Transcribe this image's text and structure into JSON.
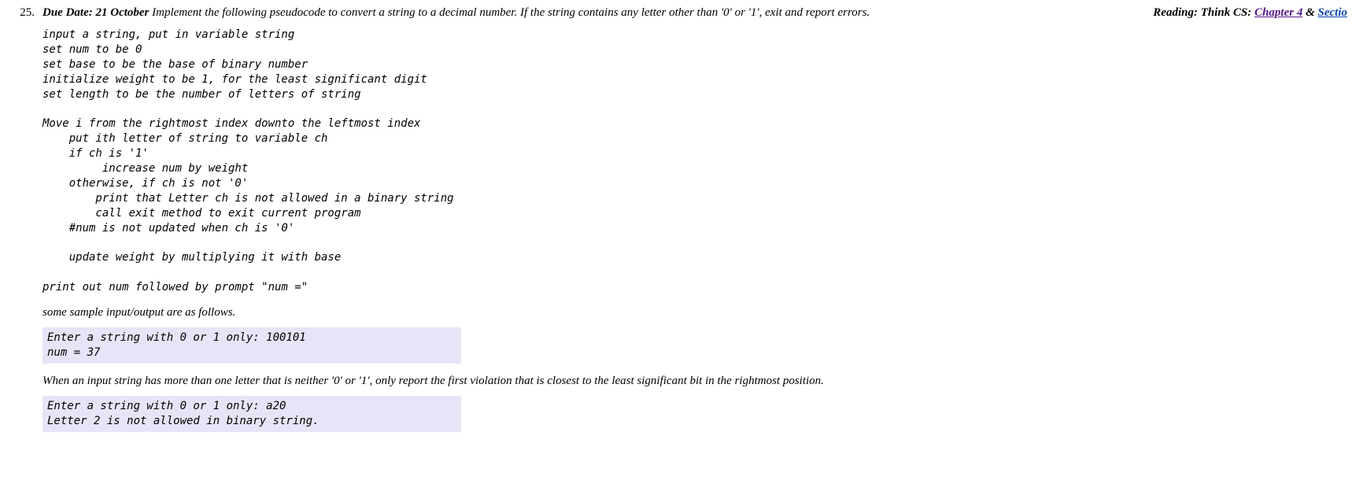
{
  "item_number": "25.",
  "due_label": "Due Date: 21 October",
  "intro_text": " Implement the following pseudocode to convert a string to a decimal number. If the string contains any letter other than '0' or '1', exit and report errors.",
  "reading_prefix": "Reading: Think CS: ",
  "reading_link1": "Chapter 4",
  "reading_sep": " & ",
  "reading_link2": "Sectio",
  "pseudocode": "input a string, put in variable string\nset num to be 0\nset base to be the base of binary number\ninitialize weight to be 1, for the least significant digit\nset length to be the number of letters of string\n\nMove i from the rightmost index downto the leftmost index\n    put ith letter of string to variable ch\n    if ch is '1'\n         increase num by weight\n    otherwise, if ch is not '0'\n        print that Letter ch is not allowed in a binary string\n        call exit method to exit current program\n    #num is not updated when ch is '0'\n\n    update weight by multiplying it with base\n\nprint out num followed by prompt \"num =\"",
  "sample_intro": "some sample input/output are as follows.",
  "sample1": "Enter a string with 0 or 1 only: 100101\nnum = 37",
  "violation_note": "When an input string has more than one letter that is neither '0' or '1', only report the first violation that is closest to the least significant bit in the rightmost position.",
  "sample2": "Enter a string with 0 or 1 only: a20\nLetter 2 is not allowed in binary string."
}
